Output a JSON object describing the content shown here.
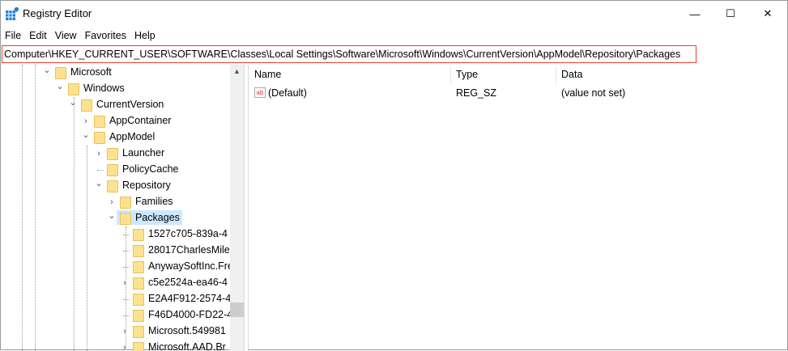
{
  "window": {
    "title": "Registry Editor",
    "minimize": "—",
    "maximize": "☐",
    "close": "✕"
  },
  "menu": [
    "File",
    "Edit",
    "View",
    "Favorites",
    "Help"
  ],
  "address": "Computer\\HKEY_CURRENT_USER\\SOFTWARE\\Classes\\Local Settings\\Software\\Microsoft\\Windows\\CurrentVersion\\AppModel\\Repository\\Packages",
  "tree": [
    {
      "label": "Microsoft",
      "level": 0,
      "state": "expanded"
    },
    {
      "label": "Windows",
      "level": 1,
      "state": "expanded"
    },
    {
      "label": "CurrentVersion",
      "level": 2,
      "state": "expanded"
    },
    {
      "label": "AppContainer",
      "level": 3,
      "state": "collapsed"
    },
    {
      "label": "AppModel",
      "level": 3,
      "state": "expanded"
    },
    {
      "label": "Launcher",
      "level": 4,
      "state": "collapsed"
    },
    {
      "label": "PolicyCache",
      "level": 4,
      "state": "none"
    },
    {
      "label": "Repository",
      "level": 4,
      "state": "expanded"
    },
    {
      "label": "Families",
      "level": 5,
      "state": "collapsed"
    },
    {
      "label": "Packages",
      "level": 5,
      "state": "expanded",
      "selected": true
    },
    {
      "label": "1527c705-839a-4",
      "level": 6,
      "state": "none"
    },
    {
      "label": "28017CharlesMile",
      "level": 6,
      "state": "none"
    },
    {
      "label": "AnywaySoftInc.Fre",
      "level": 6,
      "state": "none"
    },
    {
      "label": "c5e2524a-ea46-4",
      "level": 6,
      "state": "collapsed"
    },
    {
      "label": "E2A4F912-2574-4",
      "level": 6,
      "state": "none"
    },
    {
      "label": "F46D4000-FD22-4",
      "level": 6,
      "state": "none"
    },
    {
      "label": "Microsoft.549981",
      "level": 6,
      "state": "collapsed"
    },
    {
      "label": "Microsoft.AAD.Br",
      "level": 6,
      "state": "collapsed"
    }
  ],
  "columns": {
    "name": "Name",
    "type": "Type",
    "data": "Data"
  },
  "values": [
    {
      "name": "(Default)",
      "type": "REG_SZ",
      "data": "(value not set)",
      "icon": "ab"
    }
  ]
}
